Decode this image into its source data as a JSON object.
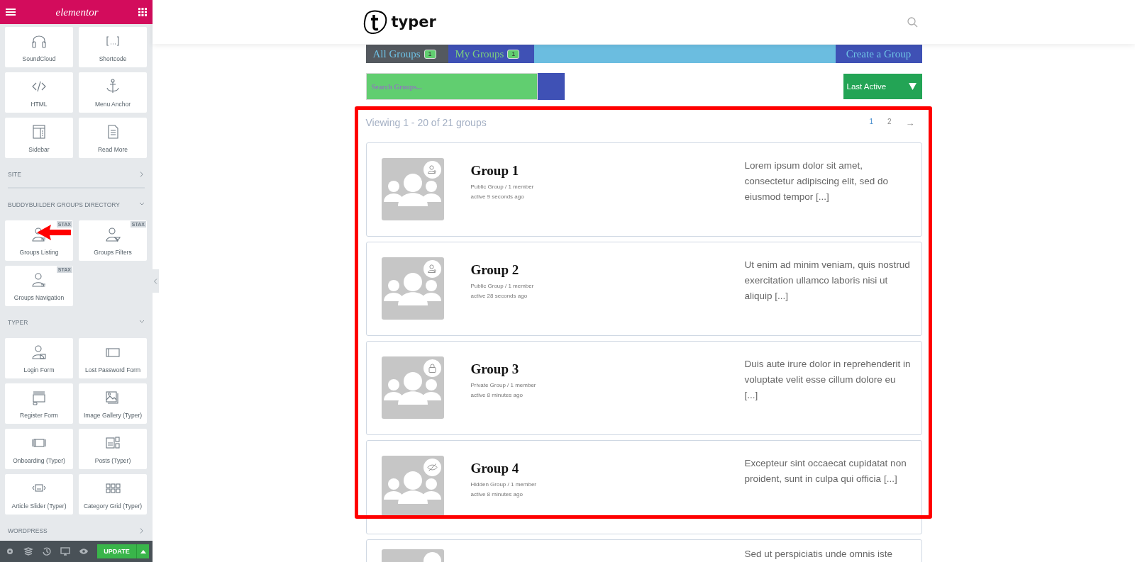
{
  "editor_panel": {
    "logo": "elementor",
    "blocks": [
      {
        "kind": "tiles",
        "items": [
          {
            "label": "SoundCloud"
          },
          {
            "label": "Shortcode"
          },
          {
            "label": "HTML"
          },
          {
            "label": "Menu Anchor"
          },
          {
            "label": "Sidebar"
          },
          {
            "label": "Read More"
          }
        ]
      },
      {
        "kind": "category",
        "label": "SITE",
        "expanded": false
      },
      {
        "kind": "category",
        "label": "BUDDYBUILDER GROUPS DIRECTORY",
        "expanded": true
      },
      {
        "kind": "tiles",
        "items": [
          {
            "label": "Groups Listing",
            "badge": "STAX"
          },
          {
            "label": "Groups Filters",
            "badge": "STAX"
          },
          {
            "label": "Groups Navigation",
            "badge": "STAX"
          }
        ]
      },
      {
        "kind": "category",
        "label": "TYPER",
        "expanded": true
      },
      {
        "kind": "tiles",
        "items": [
          {
            "label": "Login Form"
          },
          {
            "label": "Lost Password Form"
          },
          {
            "label": "Register Form"
          },
          {
            "label": "Image Gallery (Typer)"
          },
          {
            "label": "Onboarding (Typer)"
          },
          {
            "label": "Posts (Typer)"
          },
          {
            "label": "Article Slider (Typer)"
          },
          {
            "label": "Category Grid (Typer)"
          }
        ]
      },
      {
        "kind": "category",
        "label": "WORDPRESS",
        "expanded": false
      }
    ],
    "footer": {
      "update_button": "UPDATE"
    }
  },
  "site_header": {
    "logo_text": "typer"
  },
  "group_tabs": [
    {
      "label": "All Groups",
      "count": "1",
      "selected": true
    },
    {
      "label": "My Groups",
      "count": "1",
      "selected": false
    }
  ],
  "create_button": "Create a Group",
  "search": {
    "placeholder": "Search Groups..."
  },
  "sort": {
    "value": "Last Active"
  },
  "listing": {
    "summary": "Viewing 1 - 20 of 21 groups",
    "pages": [
      {
        "label": "1",
        "selected": true
      },
      {
        "label": "2",
        "selected": false
      },
      {
        "label": "→",
        "selected": false
      }
    ],
    "groups": [
      {
        "title": "Group 1",
        "kind": "public",
        "meta": "Public Group / 1 member",
        "active": "active 9 seconds ago",
        "description": "Lorem ipsum dolor sit amet, consectetur adipiscing elit, sed do eiusmod tempor [...]"
      },
      {
        "title": "Group 2",
        "kind": "public",
        "meta": "Public Group / 1 member",
        "active": "active 28 seconds ago",
        "description": "Ut enim ad minim veniam, quis nostrud exercitation ullamco laboris nisi ut aliquip [...]"
      },
      {
        "title": "Group 3",
        "kind": "private",
        "meta": "Private Group / 1 member",
        "active": "active 8 minutes ago",
        "description": "Duis aute irure dolor in reprehenderit in voluptate velit esse cillum dolore eu [...]"
      },
      {
        "title": "Group 4",
        "kind": "hidden",
        "meta": "Hidden Group / 1 member",
        "active": "active 8 minutes ago",
        "description": "Excepteur sint occaecat cupidatat non proident, sunt in culpa qui officia [...]"
      },
      {
        "description": "Sed ut perspiciatis unde omnis iste"
      }
    ]
  },
  "annotations": {
    "highlight_frame": true,
    "pointer_arrow": true
  }
}
